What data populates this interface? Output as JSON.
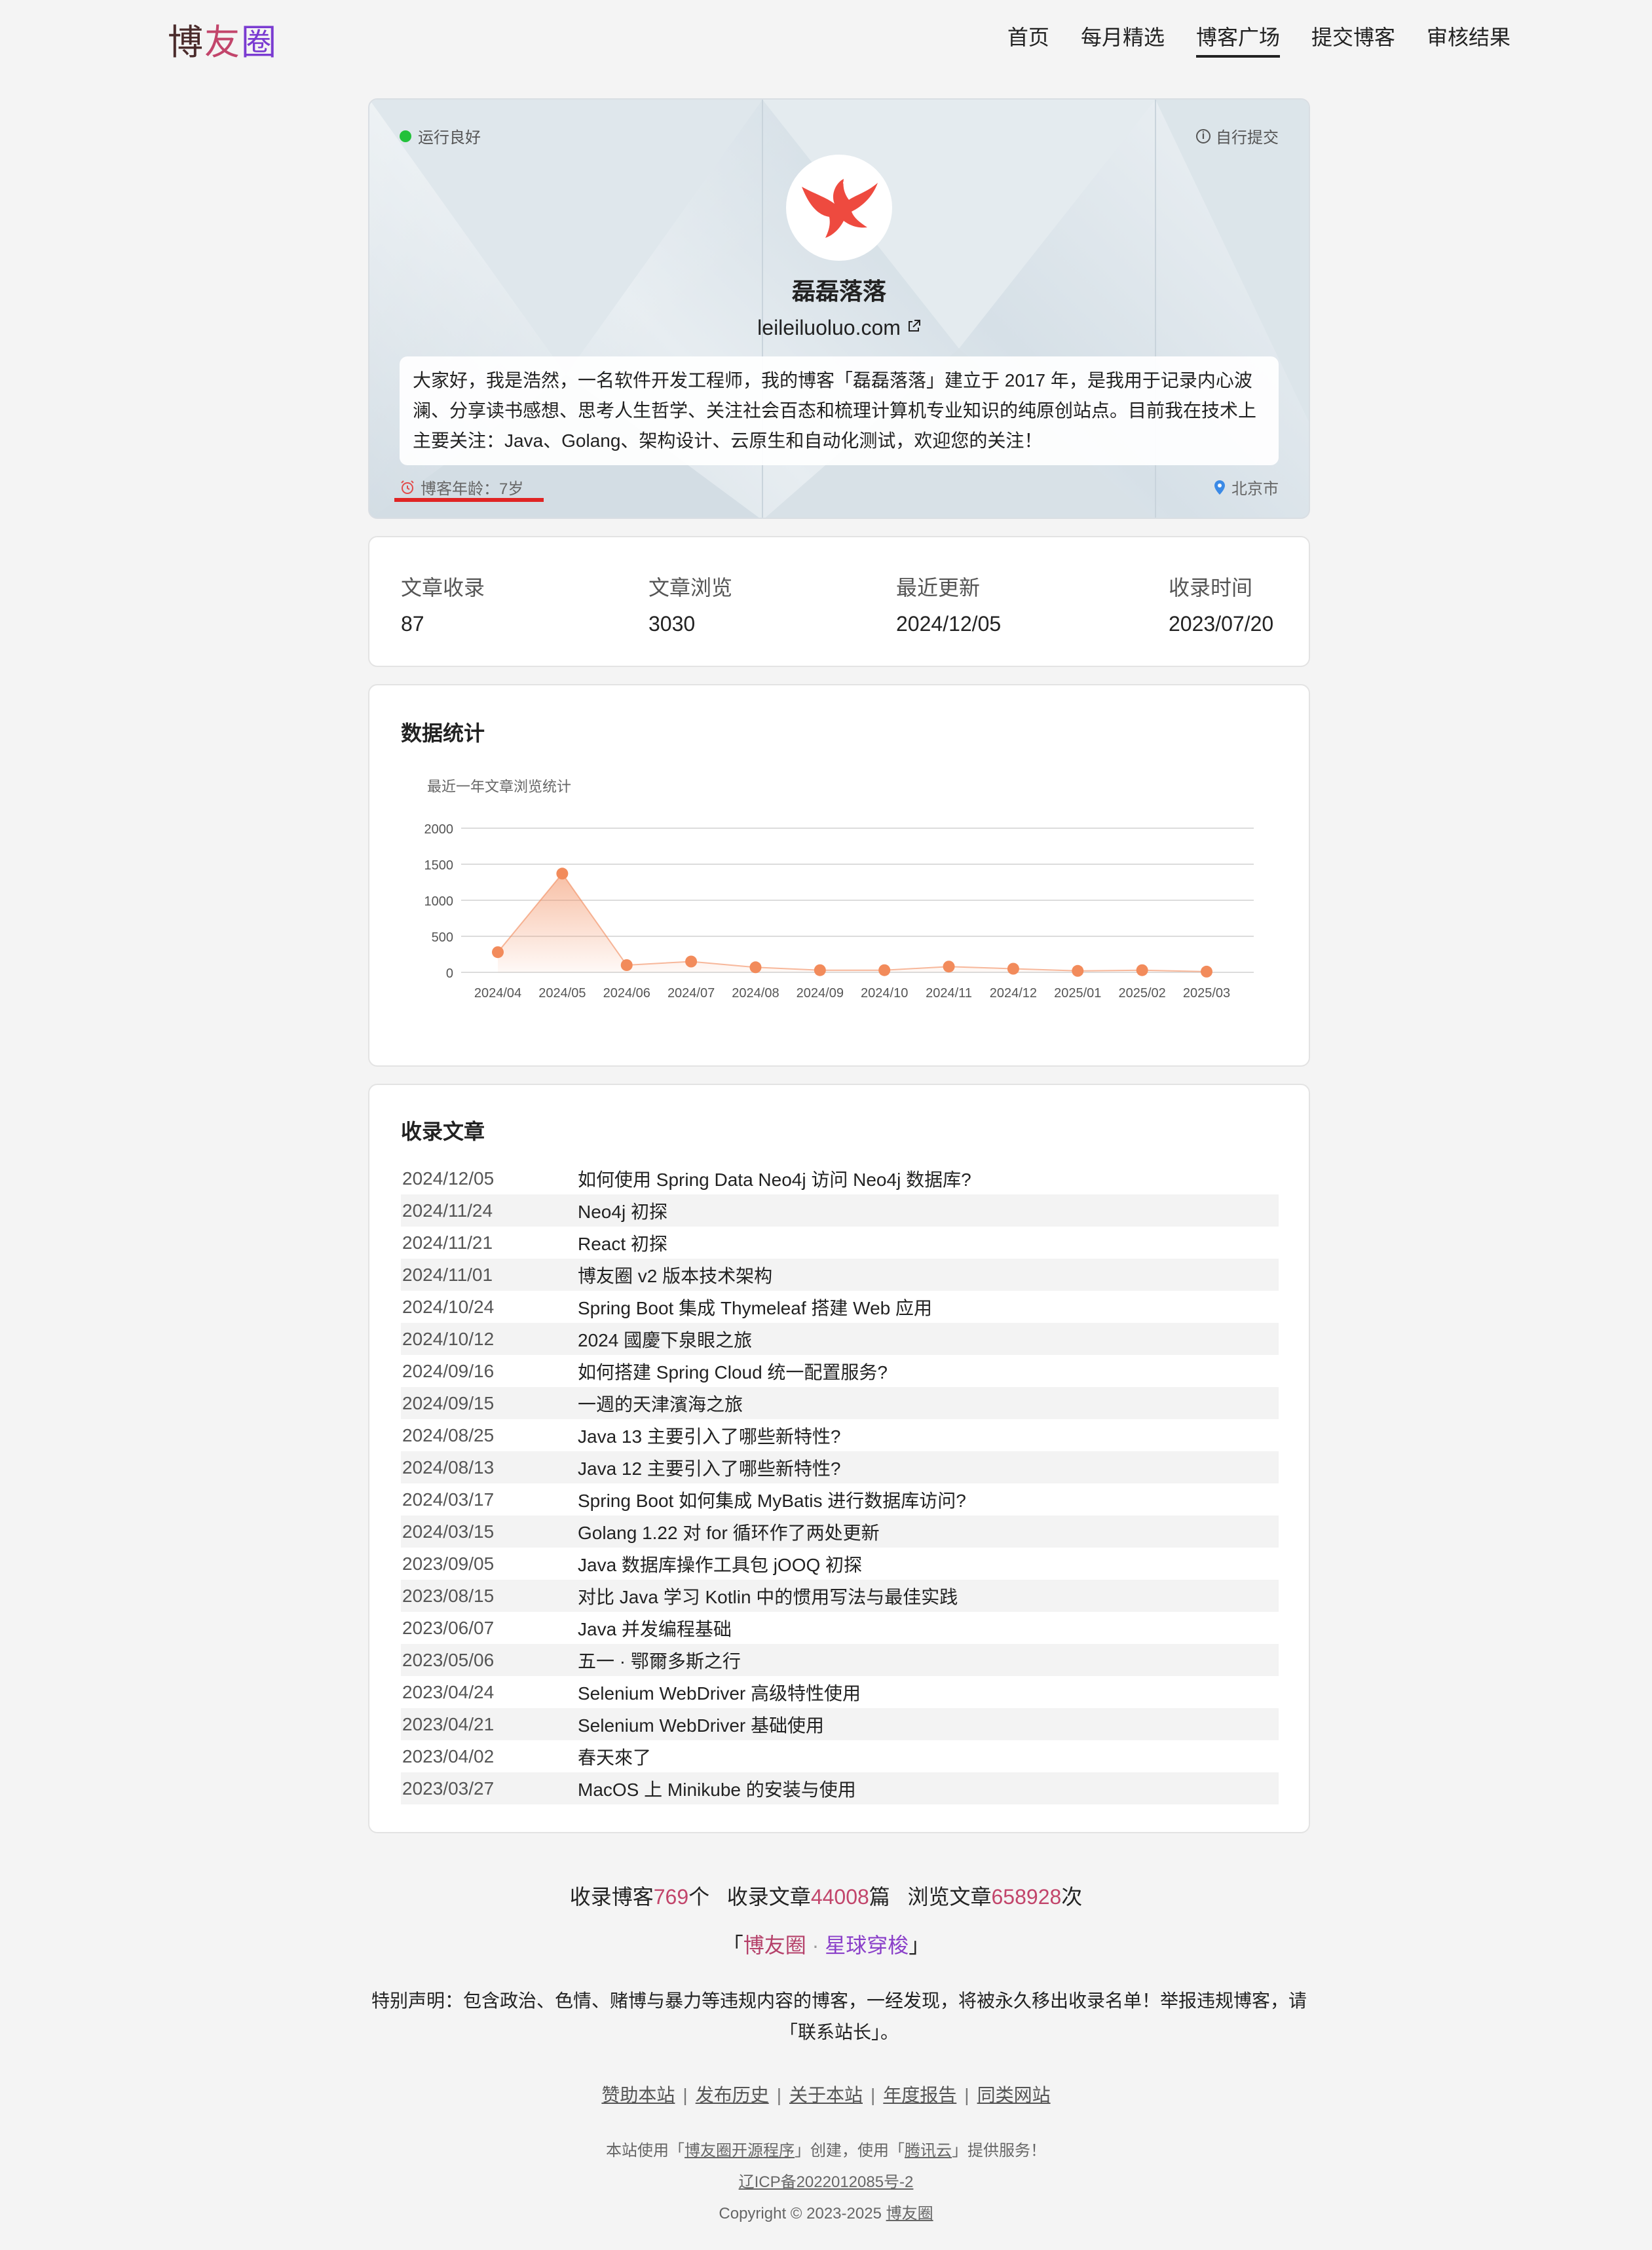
{
  "nav": {
    "logo": [
      "博",
      "友",
      "圈"
    ],
    "items": [
      "首页",
      "每月精选",
      "博客广场",
      "提交博客",
      "审核结果"
    ],
    "active_index": 2
  },
  "profile": {
    "status": "运行良好",
    "submit_type": "自行提交",
    "blog_name": "磊磊落落",
    "site": "leileiluoluo.com",
    "description": "大家好，我是浩然，一名软件开发工程师，我的博客「磊磊落落」建立于 2017 年，是我用于记录内心波澜、分享读书感想、思考人生哲学、关注社会百态和梳理计算机专业知识的纯原创站点。目前我在技术上主要关注：Java、Golang、架构设计、云原生和自动化测试，欢迎您的关注！",
    "age": "博客年龄：7岁",
    "location": "北京市",
    "status_color": "#22c13a"
  },
  "stats": [
    {
      "label": "文章收录",
      "value": "87"
    },
    {
      "label": "文章浏览",
      "value": "3030"
    },
    {
      "label": "最近更新",
      "value": "2024/12/05"
    },
    {
      "label": "收录时间",
      "value": "2023/07/20"
    }
  ],
  "chart_section_title": "数据统计",
  "chart_data": {
    "type": "area",
    "title": "最近一年文章浏览统计",
    "categories": [
      "2024/04",
      "2024/05",
      "2024/06",
      "2024/07",
      "2024/08",
      "2024/09",
      "2024/10",
      "2024/11",
      "2024/12",
      "2025/01",
      "2025/02",
      "2025/03"
    ],
    "values": [
      280,
      1370,
      100,
      150,
      70,
      30,
      30,
      80,
      50,
      20,
      30,
      10
    ],
    "yticks": [
      0,
      500,
      1000,
      1500,
      2000
    ],
    "ylim": [
      0,
      2000
    ],
    "grid": true,
    "color": "#f28b5b"
  },
  "articles_section_title": "收录文章",
  "articles": [
    {
      "date": "2024/12/05",
      "title": "如何使用 Spring Data Neo4j 访问 Neo4j 数据库?"
    },
    {
      "date": "2024/11/24",
      "title": "Neo4j 初探"
    },
    {
      "date": "2024/11/21",
      "title": "React 初探"
    },
    {
      "date": "2024/11/01",
      "title": "博友圈 v2 版本技术架构"
    },
    {
      "date": "2024/10/24",
      "title": "Spring Boot 集成 Thymeleaf 搭建 Web 应用"
    },
    {
      "date": "2024/10/12",
      "title": "2024 國慶下泉眼之旅"
    },
    {
      "date": "2024/09/16",
      "title": "如何搭建 Spring Cloud 统一配置服务?"
    },
    {
      "date": "2024/09/15",
      "title": "一週的天津濱海之旅"
    },
    {
      "date": "2024/08/25",
      "title": "Java 13 主要引入了哪些新特性?"
    },
    {
      "date": "2024/08/13",
      "title": "Java 12 主要引入了哪些新特性?"
    },
    {
      "date": "2024/03/17",
      "title": "Spring Boot 如何集成 MyBatis 进行数据库访问?"
    },
    {
      "date": "2024/03/15",
      "title": "Golang 1.22 对 for 循环作了两处更新"
    },
    {
      "date": "2023/09/05",
      "title": "Java 数据库操作工具包 jOOQ 初探"
    },
    {
      "date": "2023/08/15",
      "title": "对比 Java 学习 Kotlin 中的惯用写法与最佳实践"
    },
    {
      "date": "2023/06/07",
      "title": "Java 并发编程基础"
    },
    {
      "date": "2023/05/06",
      "title": "五一 · 鄂爾多斯之行"
    },
    {
      "date": "2023/04/24",
      "title": "Selenium WebDriver 高级特性使用"
    },
    {
      "date": "2023/04/21",
      "title": "Selenium WebDriver 基础使用"
    },
    {
      "date": "2023/04/02",
      "title": "春天來了"
    },
    {
      "date": "2023/03/27",
      "title": "MacOS 上 Minikube 的安装与使用"
    }
  ],
  "footer": {
    "summary": {
      "blogs_prefix": "收录博客",
      "blogs": "769",
      "blogs_unit": "个",
      "articles_prefix": "收录文章",
      "articles": "44008",
      "articles_unit": "篇",
      "views_prefix": "浏览文章",
      "views": "658928",
      "views_unit": "次"
    },
    "slogan": {
      "open": "「",
      "part1": "博友圈",
      "dot": " · ",
      "part2": "星球穿梭",
      "close": "」"
    },
    "notice_line1": "特别声明：包含政治、色情、赌博与暴力等违规内容的博客，一经发现，将被永久移出收录名单！举报违规博客，请",
    "notice_line2": "「联系站长」。",
    "links": [
      "赞助本站",
      "发布历史",
      "关于本站",
      "年度报告",
      "同类网站"
    ],
    "credit": {
      "p1": "本站使用「",
      "l1": "博友圈开源程序",
      "p2": "」创建，使用「",
      "l2": "腾讯云",
      "p3": "」提供服务！"
    },
    "icp": "辽ICP备2022012085号-2",
    "copyright_prefix": "Copyright © 2023-2025 ",
    "copyright_link": "博友圈"
  },
  "highlight_color": "#c2456b"
}
